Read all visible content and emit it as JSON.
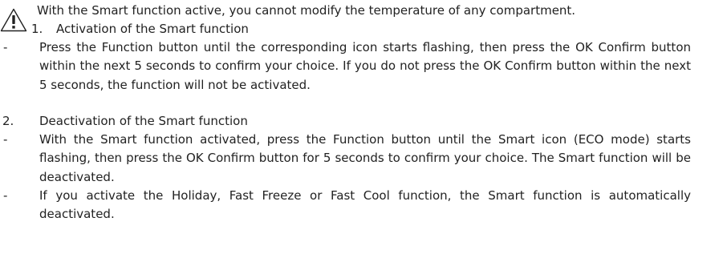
{
  "warning": {
    "text": "With the Smart function active, you cannot modify the temperature of any compartment.",
    "icon": "warning-triangle-icon"
  },
  "sections": [
    {
      "number": "1.",
      "title": "Activation of the Smart function",
      "bullets": [
        {
          "dash": "-",
          "text": "Press the Function button until the corresponding icon starts flashing, then press the OK Confirm button within the next 5 seconds to confirm your choice. If you do not press the OK Confirm button within the next 5 seconds, the function will not be activated."
        }
      ]
    },
    {
      "number": "2.",
      "title": "Deactivation of the Smart function",
      "bullets": [
        {
          "dash": "-",
          "text": "With the Smart function activated, press the Function button until the Smart icon (ECO mode) starts flashing, then press the OK Confirm button for 5 seconds to confirm your choice. The Smart function will be deactivated."
        },
        {
          "dash": "-",
          "text": "If you activate the Holiday, Fast Freeze or Fast Cool function, the Smart function is automatically deactivated."
        }
      ]
    }
  ]
}
